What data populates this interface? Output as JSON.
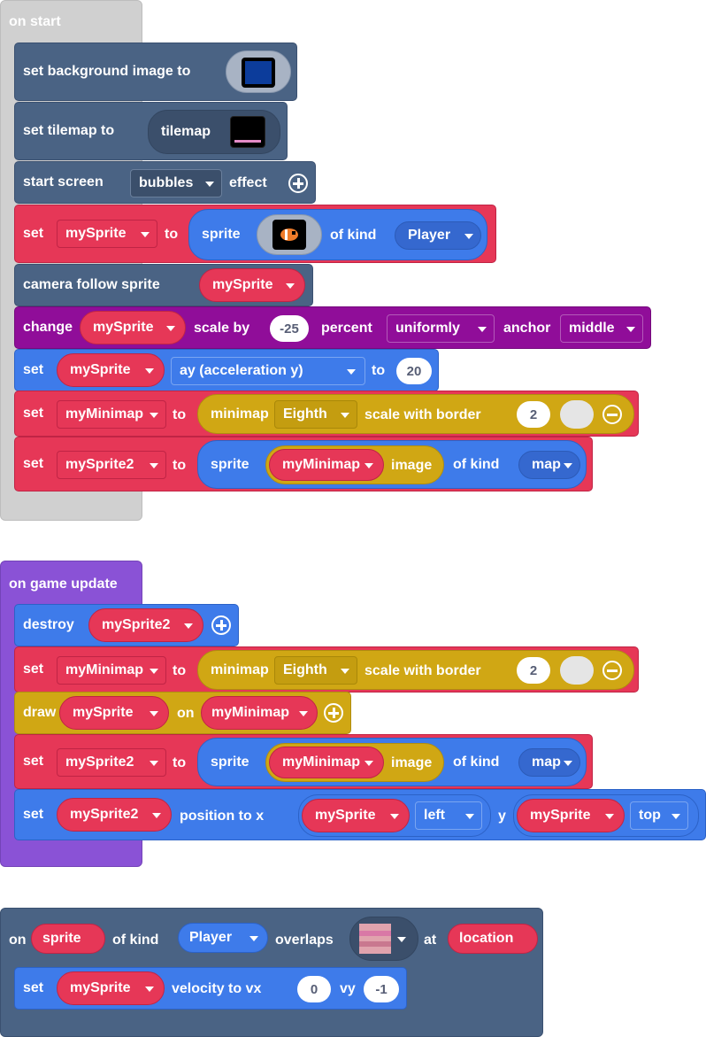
{
  "on_start": {
    "hat_label": "on start",
    "set_background": {
      "label": "set background image to"
    },
    "set_tilemap": {
      "label": "set tilemap to",
      "value": "tilemap"
    },
    "start_screen": {
      "label": "start screen",
      "effect": "bubbles",
      "suffix": "effect"
    },
    "set_mysprite": {
      "set": "set",
      "var": "mySprite",
      "to": "to",
      "sprite": "sprite",
      "of_kind": "of kind",
      "kind": "Player"
    },
    "camera": {
      "label": "camera follow sprite",
      "var": "mySprite"
    },
    "change_scale": {
      "change": "change",
      "var": "mySprite",
      "scale_by": "scale by",
      "value": "-25",
      "percent": "percent",
      "mode": "uniformly",
      "anchor": "anchor",
      "anchor_value": "middle"
    },
    "set_ay": {
      "set": "set",
      "var": "mySprite",
      "prop": "ay (acceleration y)",
      "to": "to",
      "value": "20"
    },
    "set_minimap": {
      "set": "set",
      "var": "myMinimap",
      "to": "to",
      "minimap": "minimap",
      "scale": "Eighth",
      "border": "scale with border",
      "border_value": "2"
    },
    "set_sprite2": {
      "set": "set",
      "var": "mySprite2",
      "to": "to",
      "sprite": "sprite",
      "image_var": "myMinimap",
      "image": "image",
      "of_kind": "of kind",
      "kind": "map"
    }
  },
  "on_update": {
    "hat_label": "on game update",
    "destroy": {
      "label": "destroy",
      "var": "mySprite2"
    },
    "set_minimap": {
      "set": "set",
      "var": "myMinimap",
      "to": "to",
      "minimap": "minimap",
      "scale": "Eighth",
      "border": "scale with border",
      "border_value": "2"
    },
    "draw": {
      "label": "draw",
      "var": "mySprite",
      "on": "on",
      "target": "myMinimap"
    },
    "set_sprite2": {
      "set": "set",
      "var": "mySprite2",
      "to": "to",
      "sprite": "sprite",
      "image_var": "myMinimap",
      "image": "image",
      "of_kind": "of kind",
      "kind": "map"
    },
    "set_position": {
      "set": "set",
      "var": "mySprite2",
      "position": "position to x",
      "x_var": "mySprite",
      "x_side": "left",
      "y": "y",
      "y_var": "mySprite",
      "y_side": "top"
    }
  },
  "on_overlap": {
    "on": "on",
    "var": "sprite",
    "of_kind": "of kind",
    "kind": "Player",
    "overlaps": "overlaps",
    "at": "at",
    "location": "location",
    "set_velocity": {
      "set": "set",
      "var": "mySprite",
      "velocity": "velocity to vx",
      "vx": "0",
      "vy_label": "vy",
      "vy": "-1"
    }
  },
  "colors": {
    "variables_red": "#e63757",
    "sprites_blue": "#3e7bea",
    "scene_slate": "#4a6384",
    "minimap_yellow": "#d0a714",
    "scaling_purple": "#900d99",
    "loops_gray": "#d0d0d0",
    "game_update_purple": "#8a52d6"
  }
}
